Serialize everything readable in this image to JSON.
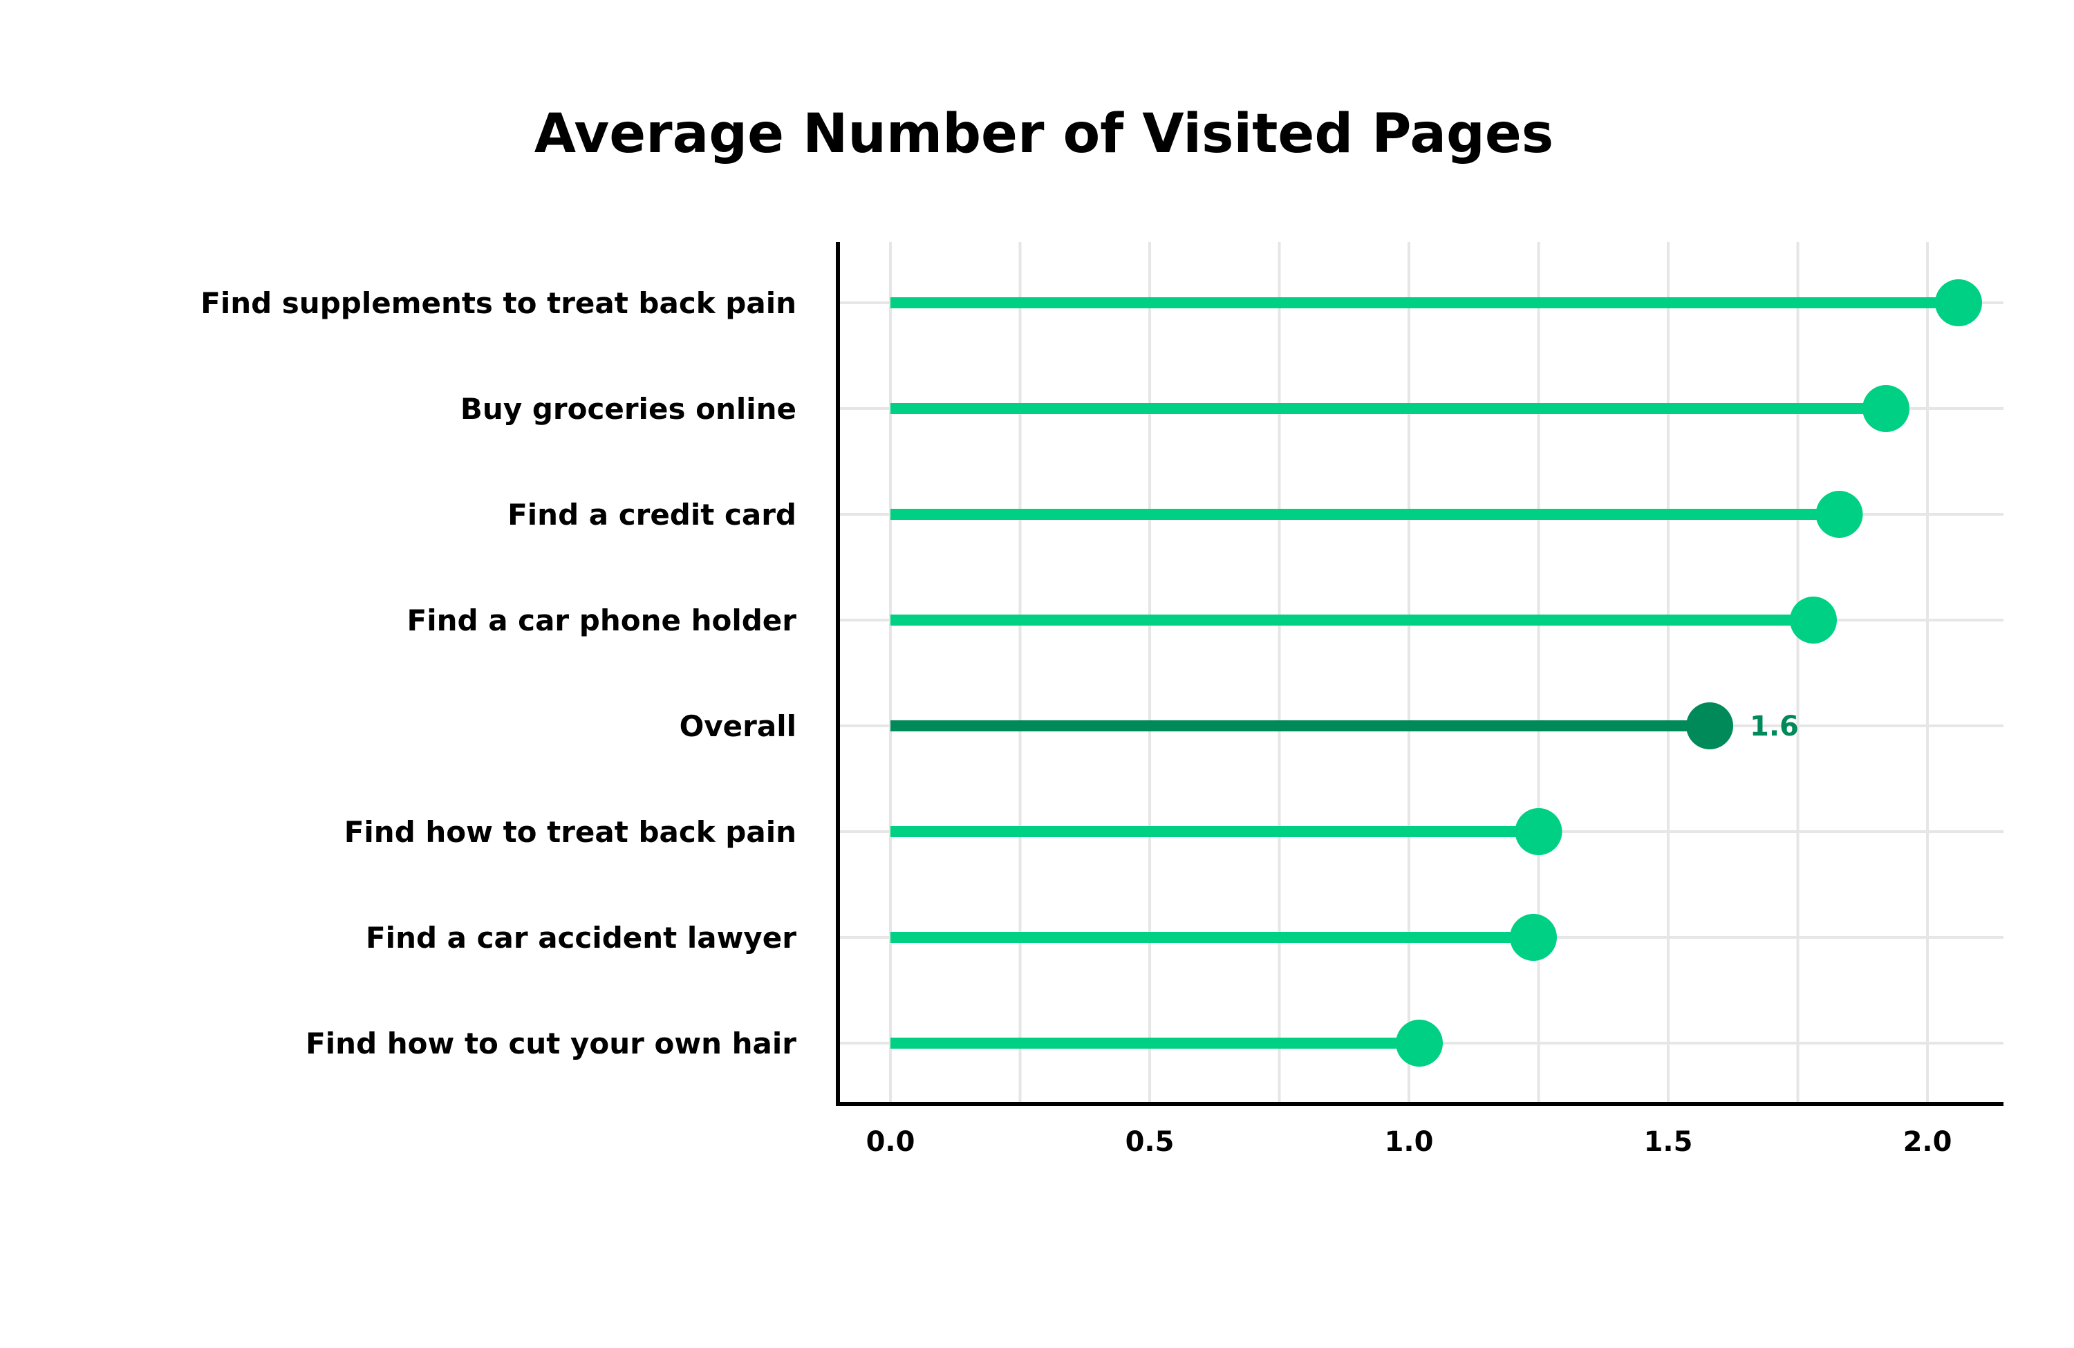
{
  "chart_data": {
    "type": "lollipop",
    "title": "Average Number of Visited Pages",
    "xlabel": "",
    "ylabel": "",
    "xlim": [
      0,
      2.15
    ],
    "xticks": [
      0.0,
      0.5,
      1.0,
      1.5,
      2.0
    ],
    "xtick_labels": [
      "0.0",
      "0.5",
      "1.0",
      "1.5",
      "2.0"
    ],
    "grid": true,
    "legend": "none",
    "categories": [
      "Find supplements to treat back pain",
      "Buy groceries online",
      "Find a credit card",
      "Find a car phone holder",
      "Overall",
      "Find how to treat back pain",
      "Find a car accident lawyer",
      "Find how to cut your own hair"
    ],
    "values": [
      2.06,
      1.92,
      1.83,
      1.78,
      1.58,
      1.25,
      1.24,
      1.02
    ],
    "highlight": {
      "category": "Overall",
      "label": "1.6"
    },
    "colors": {
      "default": "#00d084",
      "highlight": "#008a5a",
      "grid": "#e6e6e6",
      "axis": "#000000",
      "text": "#000000"
    }
  }
}
